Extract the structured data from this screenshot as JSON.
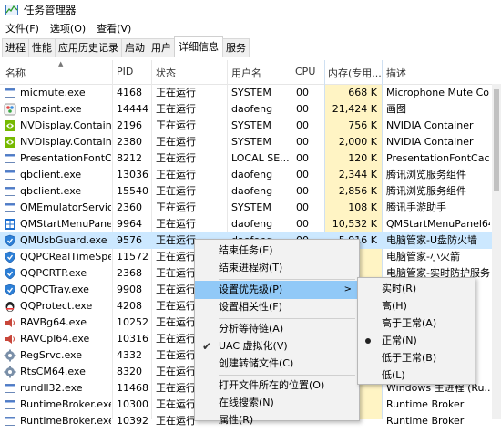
{
  "window": {
    "title": "任务管理器"
  },
  "menu": [
    "文件(F)",
    "选项(O)",
    "查看(V)"
  ],
  "tabs": [
    "进程",
    "性能",
    "应用历史记录",
    "启动",
    "用户",
    "详细信息",
    "服务"
  ],
  "active_tab": "详细信息",
  "columns": {
    "name": "名称",
    "pid": "PID",
    "status": "状态",
    "user": "用户名",
    "cpu": "CPU",
    "mem": "内存(专用...",
    "desc": "描述"
  },
  "rows": [
    {
      "name": "micmute.exe",
      "pid": "4168",
      "status": "正在运行",
      "user": "SYSTEM",
      "cpu": "00",
      "mem": "668 K",
      "desc": "Microphone Mute Co",
      "icon": "window-icon"
    },
    {
      "name": "mspaint.exe",
      "pid": "14444",
      "status": "正在运行",
      "user": "daofeng",
      "cpu": "00",
      "mem": "21,424 K",
      "desc": "画图",
      "icon": "paint-icon"
    },
    {
      "name": "NVDisplay.Contain...",
      "pid": "2196",
      "status": "正在运行",
      "user": "SYSTEM",
      "cpu": "00",
      "mem": "756 K",
      "desc": "NVIDIA Container",
      "icon": "nvidia-icon"
    },
    {
      "name": "NVDisplay.Contain...",
      "pid": "2380",
      "status": "正在运行",
      "user": "SYSTEM",
      "cpu": "00",
      "mem": "2,000 K",
      "desc": "NVIDIA Container",
      "icon": "nvidia-icon"
    },
    {
      "name": "PresentationFontC...",
      "pid": "8212",
      "status": "正在运行",
      "user": "LOCAL SE...",
      "cpu": "00",
      "mem": "120 K",
      "desc": "PresentationFontCach...",
      "icon": "window-icon"
    },
    {
      "name": "qbclient.exe",
      "pid": "13036",
      "status": "正在运行",
      "user": "daofeng",
      "cpu": "00",
      "mem": "2,344 K",
      "desc": "腾讯浏览服务组件",
      "icon": "window-icon"
    },
    {
      "name": "qbclient.exe",
      "pid": "15540",
      "status": "正在运行",
      "user": "daofeng",
      "cpu": "00",
      "mem": "2,856 K",
      "desc": "腾讯浏览服务组件",
      "icon": "window-icon"
    },
    {
      "name": "QMEmulatorServic...",
      "pid": "2360",
      "status": "正在运行",
      "user": "SYSTEM",
      "cpu": "00",
      "mem": "108 K",
      "desc": "腾讯手游助手",
      "icon": "window-icon"
    },
    {
      "name": "QMStartMenuPane...",
      "pid": "9964",
      "status": "正在运行",
      "user": "daofeng",
      "cpu": "00",
      "mem": "10,532 K",
      "desc": "QMStartMenuPanel64...",
      "icon": "qm-icon"
    },
    {
      "name": "QMUsbGuard.exe",
      "pid": "9576",
      "status": "正在运行",
      "user": "daofeng",
      "cpu": "00",
      "mem": "5,916 K",
      "desc": "电脑管家-U盘防火墙",
      "icon": "shield-icon",
      "selected": true
    },
    {
      "name": "QQPCRealTimeSpe...",
      "pid": "11572",
      "status": "正在运行",
      "user": "",
      "cpu": "",
      "mem": "",
      "desc": "电脑管家-小火箭",
      "icon": "shield-icon"
    },
    {
      "name": "QQPCRTP.exe",
      "pid": "2368",
      "status": "正在运行",
      "user": "",
      "cpu": "",
      "mem": "",
      "desc": "电脑管家-实时防护服务",
      "icon": "shield-icon"
    },
    {
      "name": "QQPCTray.exe",
      "pid": "9908",
      "status": "正在运行",
      "user": "",
      "cpu": "",
      "mem": "",
      "desc": "",
      "icon": "shield-icon"
    },
    {
      "name": "QQProtect.exe",
      "pid": "4208",
      "status": "正在运行",
      "user": "",
      "cpu": "",
      "mem": "",
      "desc": "",
      "icon": "qq-icon"
    },
    {
      "name": "RAVBg64.exe",
      "pid": "10252",
      "status": "正在运行",
      "user": "",
      "cpu": "",
      "mem": "",
      "desc": "",
      "icon": "speaker-icon"
    },
    {
      "name": "RAVCpl64.exe",
      "pid": "10316",
      "status": "正在运行",
      "user": "",
      "cpu": "",
      "mem": "",
      "desc": "",
      "icon": "speaker-icon"
    },
    {
      "name": "RegSrvc.exe",
      "pid": "4332",
      "status": "正在运行",
      "user": "",
      "cpu": "",
      "mem": "",
      "desc": "",
      "icon": "gear-icon"
    },
    {
      "name": "RtsCM64.exe",
      "pid": "8320",
      "status": "正在运行",
      "user": "",
      "cpu": "",
      "mem": "",
      "desc": "",
      "icon": "gear-icon"
    },
    {
      "name": "rundll32.exe",
      "pid": "11468",
      "status": "正在运行",
      "user": "",
      "cpu": "",
      "mem": "",
      "desc": "Windows 主进程 (Ru...",
      "icon": "window-icon"
    },
    {
      "name": "RuntimeBroker.exe",
      "pid": "10300",
      "status": "正在运行",
      "user": "",
      "cpu": "",
      "mem": "",
      "desc": "Runtime Broker",
      "icon": "window-icon"
    },
    {
      "name": "RuntimeBroker.exe",
      "pid": "10392",
      "status": "正在运行",
      "user": "",
      "cpu": "",
      "mem": "",
      "desc": "Runtime Broker",
      "icon": "window-icon"
    }
  ],
  "context_menu": {
    "items": [
      "结束任务(E)",
      "结束进程树(T)",
      "设置优先级(P)",
      "设置相关性(F)",
      "分析等待链(A)",
      "UAC 虚拟化(V)",
      "创建转储文件(C)",
      "打开文件所在的位置(O)",
      "在线搜索(N)",
      "属性(R)"
    ],
    "uac_checked": true
  },
  "priority_menu": {
    "items": [
      "实时(R)",
      "高(H)",
      "高于正常(A)",
      "正常(N)",
      "低于正常(B)",
      "低(L)"
    ],
    "selected": "正常(N)"
  },
  "colors": {
    "selection": "#cce8ff",
    "memory_column": "#fff4c4",
    "menu_highlight": "#91c9f7",
    "shield": "#2d7fd6"
  }
}
